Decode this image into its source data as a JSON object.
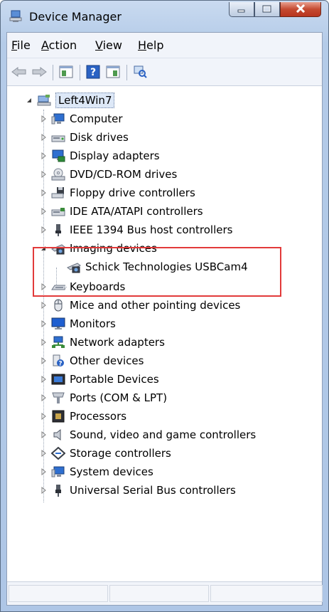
{
  "window": {
    "title": "Device Manager"
  },
  "menubar": {
    "items": [
      {
        "label": "File",
        "accel": "F",
        "rest": "ile"
      },
      {
        "label": "Action",
        "accel": "A",
        "rest": "ction"
      },
      {
        "label": "View",
        "accel": "V",
        "rest": "iew"
      },
      {
        "label": "Help",
        "accel": "H",
        "rest": "elp"
      }
    ]
  },
  "toolbar": {
    "icons": [
      "back-arrow-icon",
      "forward-arrow-icon",
      "show-hide-console-tree-icon",
      "help-icon",
      "action-pane-icon",
      "scan-hardware-icon"
    ]
  },
  "tree": {
    "root": {
      "label": "Left4Win7",
      "icon": "computer-network-icon"
    },
    "items": [
      {
        "label": "Computer",
        "icon": "computer-icon"
      },
      {
        "label": "Disk drives",
        "icon": "disk-drive-icon"
      },
      {
        "label": "Display adapters",
        "icon": "display-adapter-icon"
      },
      {
        "label": "DVD/CD-ROM drives",
        "icon": "dvd-drive-icon"
      },
      {
        "label": "Floppy drive controllers",
        "icon": "floppy-icon"
      },
      {
        "label": "IDE ATA/ATAPI controllers",
        "icon": "ide-controller-icon"
      },
      {
        "label": "IEEE 1394 Bus host controllers",
        "icon": "firewire-icon"
      },
      {
        "label": "Imaging devices",
        "icon": "imaging-device-icon",
        "expanded": true
      },
      {
        "label": "Schick Technologies USBCam4",
        "icon": "camera-icon",
        "child": true
      },
      {
        "label": "Keyboards",
        "icon": "keyboard-icon"
      },
      {
        "label": "Mice and other pointing devices",
        "icon": "mouse-icon"
      },
      {
        "label": "Monitors",
        "icon": "monitor-icon"
      },
      {
        "label": "Network adapters",
        "icon": "network-adapter-icon"
      },
      {
        "label": "Other devices",
        "icon": "unknown-device-icon"
      },
      {
        "label": "Portable Devices",
        "icon": "portable-device-icon"
      },
      {
        "label": "Ports (COM & LPT)",
        "icon": "port-icon"
      },
      {
        "label": "Processors",
        "icon": "processor-icon"
      },
      {
        "label": "Sound, video and game controllers",
        "icon": "speaker-icon"
      },
      {
        "label": "Storage controllers",
        "icon": "storage-controller-icon"
      },
      {
        "label": "System devices",
        "icon": "system-device-icon"
      },
      {
        "label": "Universal Serial Bus controllers",
        "icon": "usb-icon"
      }
    ]
  },
  "colors": {
    "highlight_border": "#e23a3a",
    "title_bar": "#b9cde9",
    "close_button": "#c44a31"
  }
}
